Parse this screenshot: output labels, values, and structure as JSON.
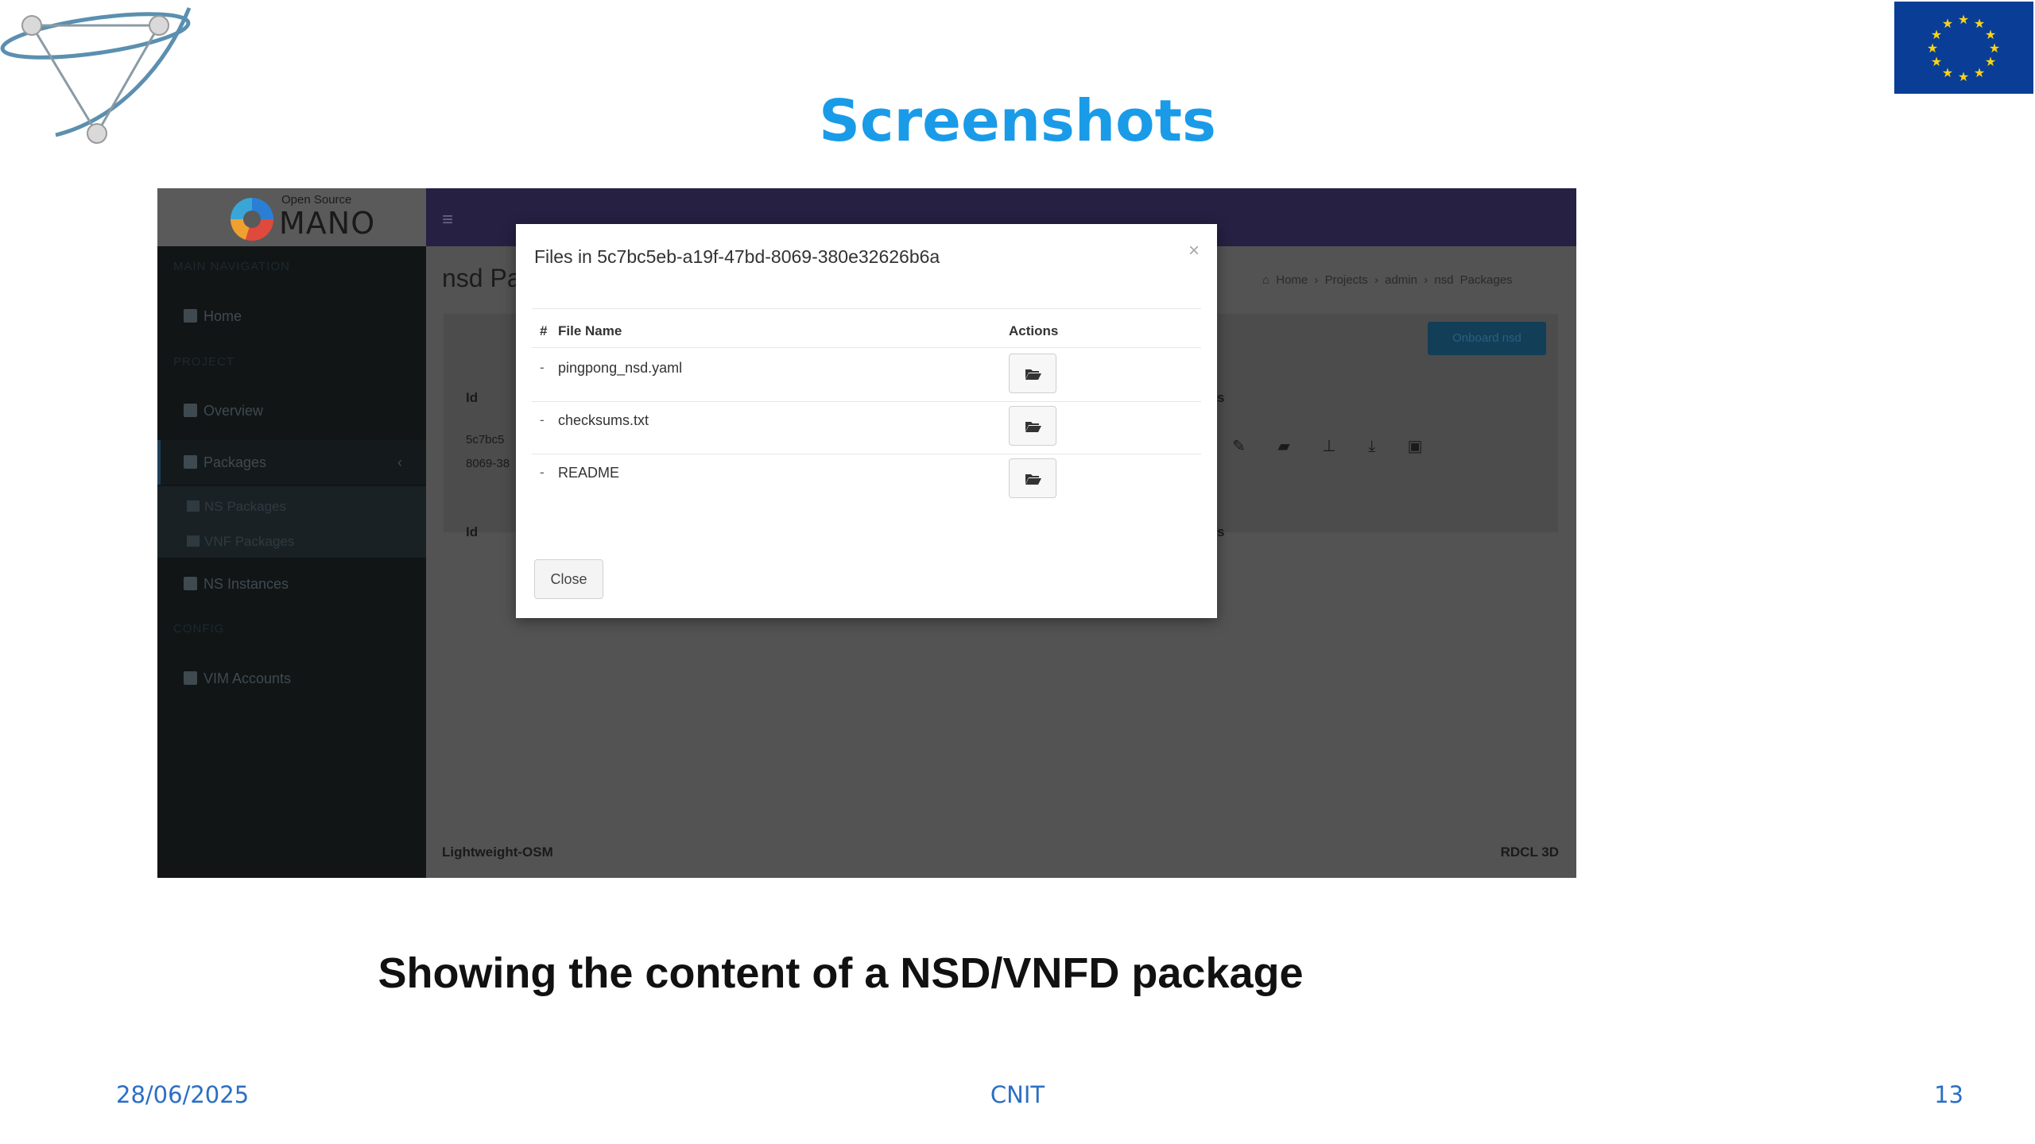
{
  "slide": {
    "title": "Screenshots",
    "caption": "Showing the content of a NSD/VNFD package",
    "footer": {
      "date": "28/06/2025",
      "organization": "CNIT",
      "page_number": "13"
    }
  },
  "app": {
    "brand": {
      "small": "Open Source",
      "big": "MANO"
    },
    "sidebar": {
      "sections": [
        "MAIN NAVIGATION",
        "PROJECT",
        "Config"
      ],
      "items": [
        {
          "label": "Home",
          "icon": "home-icon"
        },
        {
          "label": "Overview",
          "icon": "file-icon"
        },
        {
          "label": "Packages",
          "icon": "box-icon"
        },
        {
          "label": "NS Instances",
          "icon": "list-icon"
        },
        {
          "label": "VIM Accounts",
          "icon": "list-icon"
        }
      ],
      "subitems": [
        {
          "label": "NS Packages"
        },
        {
          "label": "VNF Packages"
        }
      ]
    },
    "page_heading": "nsd Pa",
    "breadcrumb": [
      "Home",
      "Projects",
      "admin",
      "nsd Packages"
    ],
    "onboard_button": "Onboard nsd",
    "table_bg": {
      "id_header": "Id",
      "id_header_2": "Id",
      "row_id_1": "5c7bc5",
      "row_id_2": "8069-38",
      "col_frag": "s",
      "col_frag_2": "s"
    },
    "footer": {
      "left": "Lightweight-OSM",
      "right": "RDCL 3D"
    },
    "modal": {
      "title": "Files in 5c7bc5eb-a19f-47bd-8069-380e32626b6a",
      "close_x": "×",
      "columns": {
        "index": "#",
        "file_name": "File Name",
        "actions": "Actions"
      },
      "files": [
        {
          "index": "-",
          "name": "pingpong_nsd.yaml"
        },
        {
          "index": "-",
          "name": "checksums.txt"
        },
        {
          "index": "-",
          "name": "README"
        }
      ],
      "close_button": "Close"
    }
  },
  "colors": {
    "title_blue": "#1a9be8",
    "footer_blue": "#2b6fc4",
    "eu_blue": "#0a3d96",
    "eu_star": "#f7d418"
  }
}
